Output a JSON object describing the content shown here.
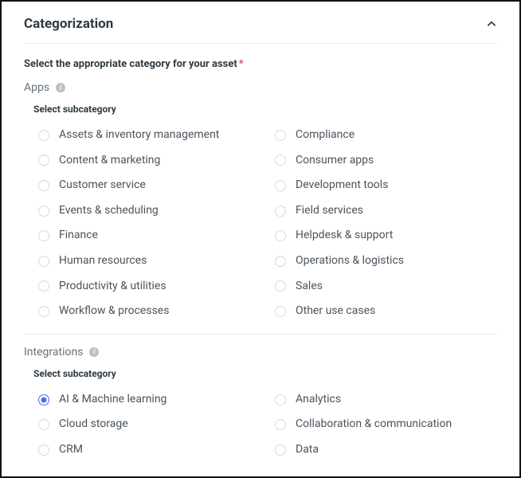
{
  "panel": {
    "title": "Categorization",
    "expanded": true
  },
  "instruction": "Select the appropriate category for your asset",
  "required": true,
  "subcategory_heading": "Select subcategory",
  "categories": [
    {
      "name": "Apps",
      "key": "apps",
      "options": [
        {
          "label": "Assets & inventory management",
          "selected": false
        },
        {
          "label": "Compliance",
          "selected": false
        },
        {
          "label": "Content & marketing",
          "selected": false
        },
        {
          "label": "Consumer apps",
          "selected": false
        },
        {
          "label": "Customer service",
          "selected": false
        },
        {
          "label": "Development tools",
          "selected": false
        },
        {
          "label": "Events & scheduling",
          "selected": false
        },
        {
          "label": "Field services",
          "selected": false
        },
        {
          "label": "Finance",
          "selected": false
        },
        {
          "label": "Helpdesk & support",
          "selected": false
        },
        {
          "label": "Human resources",
          "selected": false
        },
        {
          "label": "Operations & logistics",
          "selected": false
        },
        {
          "label": "Productivity & utilities",
          "selected": false
        },
        {
          "label": "Sales",
          "selected": false
        },
        {
          "label": "Workflow & processes",
          "selected": false
        },
        {
          "label": "Other use cases",
          "selected": false
        }
      ]
    },
    {
      "name": "Integrations",
      "key": "integrations",
      "options": [
        {
          "label": "AI & Machine learning",
          "selected": true
        },
        {
          "label": "Analytics",
          "selected": false
        },
        {
          "label": "Cloud storage",
          "selected": false
        },
        {
          "label": "Collaboration & communication",
          "selected": false
        },
        {
          "label": "CRM",
          "selected": false
        },
        {
          "label": "Data",
          "selected": false
        }
      ]
    }
  ]
}
